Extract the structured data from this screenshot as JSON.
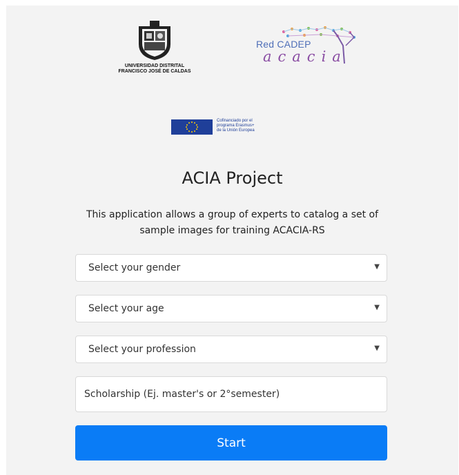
{
  "logos": {
    "university_line1": "UNIVERSIDAD DISTRITAL",
    "university_line2": "FRANCISCO JOSÉ DE CALDAS",
    "cadep_label": "Red CADEP",
    "acacia_label": "acacia",
    "eu_line1": "Cofinanciado por el",
    "eu_line2": "programa Erasmus+",
    "eu_line3": "de la Unión Europea"
  },
  "page": {
    "title": "ACIA Project",
    "description": "This application allows a group of experts to catalog a set of sample images for training ACACIA-RS"
  },
  "form": {
    "gender_placeholder": "Select your gender",
    "age_placeholder": "Select your age",
    "profession_placeholder": "Select your profession",
    "scholarship_placeholder": "Scholarship (Ej. master's or 2°semester)",
    "start_label": "Start"
  },
  "icons": {
    "dropdown_caret": "▼"
  },
  "colors": {
    "primary": "#0a7cf6",
    "panel_bg": "#f3f3f3",
    "eu_blue": "#1f3f99",
    "eu_star": "#ffcc00"
  }
}
